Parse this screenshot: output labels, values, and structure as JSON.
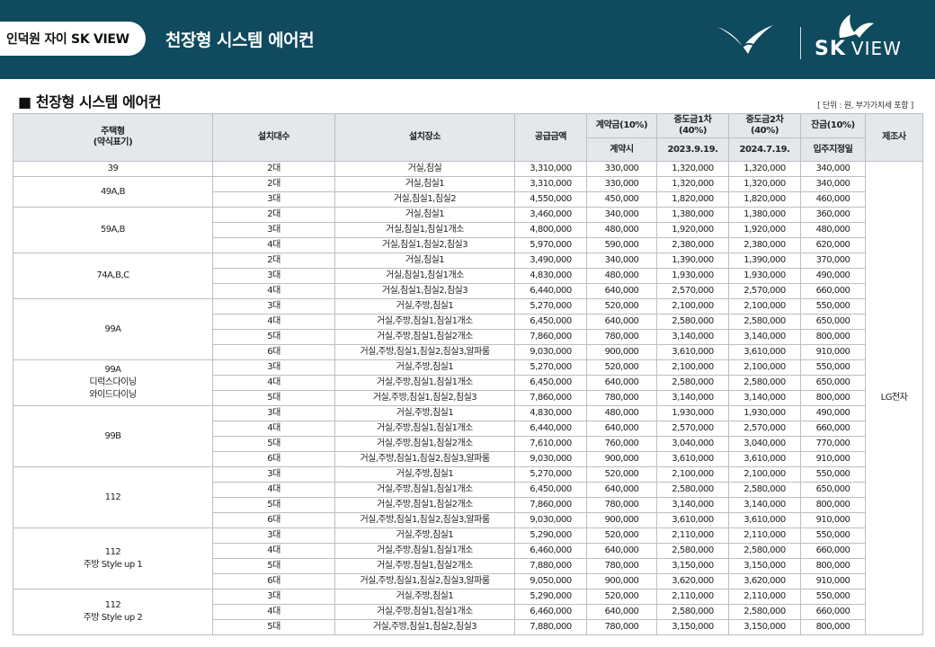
{
  "header": {
    "badge": "인덕원 자이 SK VIEW",
    "title": "천장형 시스템 에어컨",
    "logo_sk": "SK",
    "logo_view": "VIEW"
  },
  "section": {
    "title": "■ 천장형 시스템 에어컨",
    "unit_note": "[ 단위 : 원, 부가가치세 포함 ]"
  },
  "table": {
    "headers": {
      "type": "주택형\n(약식표기)",
      "units": "설치대수",
      "location": "설치장소",
      "price": "공급금액",
      "contract": "계약금(10%)",
      "mid1": "중도금1차\n(40%)",
      "mid2": "중도금2차\n(40%)",
      "balance": "잔금(10%)",
      "maker": "제조사",
      "contract_date": "계약시",
      "mid1_date": "2023.9.19.",
      "mid2_date": "2024.7.19.",
      "balance_date": "입주지정일"
    },
    "manufacturer": "LG전자",
    "groups": [
      {
        "name": "39",
        "rows": [
          [
            "2대",
            "거실,침실",
            "3,310,000",
            "330,000",
            "1,320,000",
            "1,320,000",
            "340,000"
          ]
        ]
      },
      {
        "name": "49A,B",
        "rows": [
          [
            "2대",
            "거실,침실1",
            "3,310,000",
            "330,000",
            "1,320,000",
            "1,320,000",
            "340,000"
          ],
          [
            "3대",
            "거실,침실1,침실2",
            "4,550,000",
            "450,000",
            "1,820,000",
            "1,820,000",
            "460,000"
          ]
        ]
      },
      {
        "name": "59A,B",
        "rows": [
          [
            "2대",
            "거실,침실1",
            "3,460,000",
            "340,000",
            "1,380,000",
            "1,380,000",
            "360,000"
          ],
          [
            "3대",
            "거실,침실1,침실1개소",
            "4,800,000",
            "480,000",
            "1,920,000",
            "1,920,000",
            "480,000"
          ],
          [
            "4대",
            "거실,침실1,침실2,침실3",
            "5,970,000",
            "590,000",
            "2,380,000",
            "2,380,000",
            "620,000"
          ]
        ]
      },
      {
        "name": "74A,B,C",
        "rows": [
          [
            "2대",
            "거실,침실1",
            "3,490,000",
            "340,000",
            "1,390,000",
            "1,390,000",
            "370,000"
          ],
          [
            "3대",
            "거실,침실1,침실1개소",
            "4,830,000",
            "480,000",
            "1,930,000",
            "1,930,000",
            "490,000"
          ],
          [
            "4대",
            "거실,침실1,침실2,침실3",
            "6,440,000",
            "640,000",
            "2,570,000",
            "2,570,000",
            "660,000"
          ]
        ]
      },
      {
        "name": "99A",
        "rows": [
          [
            "3대",
            "거실,주방,침실1",
            "5,270,000",
            "520,000",
            "2,100,000",
            "2,100,000",
            "550,000"
          ],
          [
            "4대",
            "거실,주방,침실1,침실1개소",
            "6,450,000",
            "640,000",
            "2,580,000",
            "2,580,000",
            "650,000"
          ],
          [
            "5대",
            "거실,주방,침실1,침실2개소",
            "7,860,000",
            "780,000",
            "3,140,000",
            "3,140,000",
            "800,000"
          ],
          [
            "6대",
            "거실,주방,침실1,침실2,침실3,알파룸",
            "9,030,000",
            "900,000",
            "3,610,000",
            "3,610,000",
            "910,000"
          ]
        ]
      },
      {
        "name": "99A\n디럭스다이닝\n와이드다이닝",
        "rows": [
          [
            "3대",
            "거실,주방,침실1",
            "5,270,000",
            "520,000",
            "2,100,000",
            "2,100,000",
            "550,000"
          ],
          [
            "4대",
            "거실,주방,침실1,침실1개소",
            "6,450,000",
            "640,000",
            "2,580,000",
            "2,580,000",
            "650,000"
          ],
          [
            "5대",
            "거실,주방,침실1,침실2,침실3",
            "7,860,000",
            "780,000",
            "3,140,000",
            "3,140,000",
            "800,000"
          ]
        ]
      },
      {
        "name": "99B",
        "rows": [
          [
            "3대",
            "거실,주방,침실1",
            "4,830,000",
            "480,000",
            "1,930,000",
            "1,930,000",
            "490,000"
          ],
          [
            "4대",
            "거실,주방,침실1,침실1개소",
            "6,440,000",
            "640,000",
            "2,570,000",
            "2,570,000",
            "660,000"
          ],
          [
            "5대",
            "거실,주방,침실1,침실2개소",
            "7,610,000",
            "760,000",
            "3,040,000",
            "3,040,000",
            "770,000"
          ],
          [
            "6대",
            "거실,주방,침실1,침실2,침실3,알파룸",
            "9,030,000",
            "900,000",
            "3,610,000",
            "3,610,000",
            "910,000"
          ]
        ]
      },
      {
        "name": "112",
        "rows": [
          [
            "3대",
            "거실,주방,침실1",
            "5,270,000",
            "520,000",
            "2,100,000",
            "2,100,000",
            "550,000"
          ],
          [
            "4대",
            "거실,주방,침실1,침실1개소",
            "6,450,000",
            "640,000",
            "2,580,000",
            "2,580,000",
            "650,000"
          ],
          [
            "5대",
            "거실,주방,침실1,침실2개소",
            "7,860,000",
            "780,000",
            "3,140,000",
            "3,140,000",
            "800,000"
          ],
          [
            "6대",
            "거실,주방,침실1,침실2,침실3,알파룸",
            "9,030,000",
            "900,000",
            "3,610,000",
            "3,610,000",
            "910,000"
          ]
        ]
      },
      {
        "name": "112\n주방 Style up 1",
        "rows": [
          [
            "3대",
            "거실,주방,침실1",
            "5,290,000",
            "520,000",
            "2,110,000",
            "2,110,000",
            "550,000"
          ],
          [
            "4대",
            "거실,주방,침실1,침실1개소",
            "6,460,000",
            "640,000",
            "2,580,000",
            "2,580,000",
            "660,000"
          ],
          [
            "5대",
            "거실,주방,침실1,침실2개소",
            "7,880,000",
            "780,000",
            "3,150,000",
            "3,150,000",
            "800,000"
          ],
          [
            "6대",
            "거실,주방,침실1,침실2,침실3,알파룸",
            "9,050,000",
            "900,000",
            "3,620,000",
            "3,620,000",
            "910,000"
          ]
        ]
      },
      {
        "name": "112\n주방 Style up 2",
        "rows": [
          [
            "3대",
            "거실,주방,침실1",
            "5,290,000",
            "520,000",
            "2,110,000",
            "2,110,000",
            "550,000"
          ],
          [
            "4대",
            "거실,주방,침실1,침실1개소",
            "6,460,000",
            "640,000",
            "2,580,000",
            "2,580,000",
            "660,000"
          ],
          [
            "5대",
            "거실,주방,침실1,침실2,침실3",
            "7,880,000",
            "780,000",
            "3,150,000",
            "3,150,000",
            "800,000"
          ]
        ]
      }
    ]
  }
}
